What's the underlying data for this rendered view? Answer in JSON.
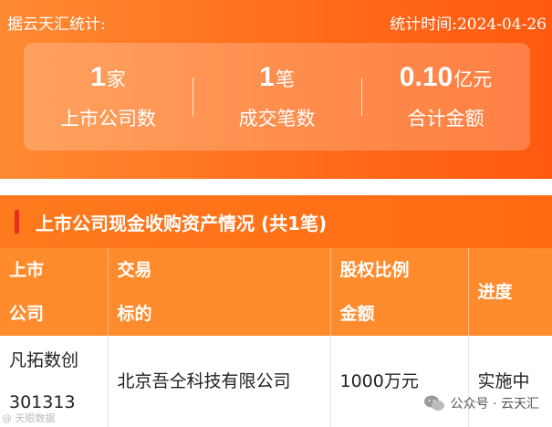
{
  "header": {
    "source": "据云天汇统计:",
    "date": "统计时间:2024-04-26"
  },
  "stats": [
    {
      "value": "1",
      "unit": "家",
      "label": "上市公司数"
    },
    {
      "value": "1",
      "unit": "笔",
      "label": "成交笔数"
    },
    {
      "value": "0.10",
      "unit": "亿元",
      "label": "合计金额"
    }
  ],
  "section": {
    "title": "上市公司现金收购资产情况  (共1笔)"
  },
  "table": {
    "headers": [
      {
        "line1": "上市",
        "line2": "公司"
      },
      {
        "line1": "交易",
        "line2": "标的"
      },
      {
        "line1": "股权比例",
        "line2": "金额"
      },
      {
        "line1": "进度",
        "line2": ""
      }
    ],
    "rows": [
      {
        "company": "凡拓数创",
        "code": "301313",
        "target": "北京吾仝科技有限公司",
        "amount": "1000万元",
        "progress": "实施中"
      }
    ]
  },
  "watermark": {
    "left": "@ 天眼数据",
    "right": "公众号 · 云天汇"
  },
  "colors": {
    "brand_orange": "#ff6a1a",
    "header_cell": "#ff8b2c",
    "accent_red": "#e8301a"
  }
}
